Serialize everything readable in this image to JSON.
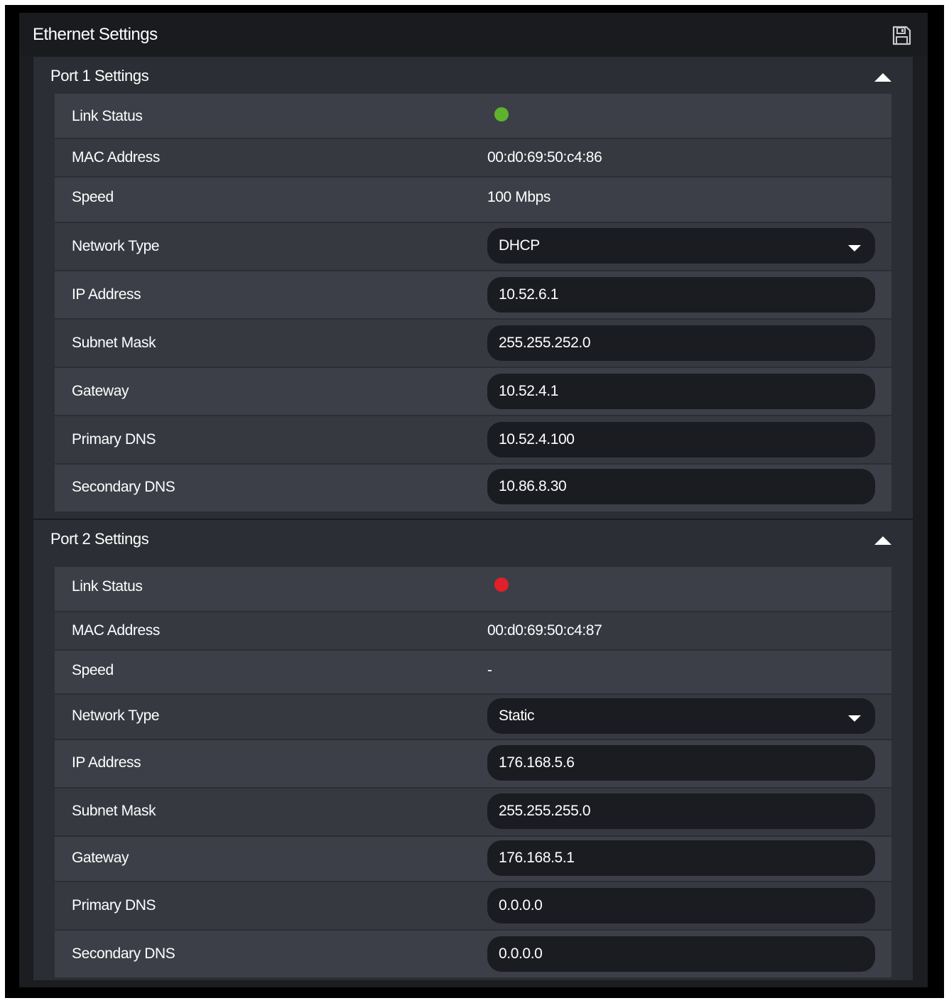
{
  "panel": {
    "title": "Ethernet Settings",
    "save_icon": "floppy-disk-save-icon"
  },
  "colors": {
    "link_up": "#5db32d",
    "link_down": "#e0202a",
    "panel_bg": "#1c1d20",
    "field_bg": "#1a1c21"
  },
  "ports": [
    {
      "title": "Port 1 Settings",
      "collapse_icon": "caret-up-icon",
      "link_status_label": "Link Status",
      "link_status": "up",
      "mac_label": "MAC Address",
      "mac": "00:d0:69:50:c4:86",
      "speed_label": "Speed",
      "speed": "100 Mbps",
      "network_type_label": "Network Type",
      "network_type": "DHCP",
      "ip_label": "IP Address",
      "ip": "10.52.6.1",
      "subnet_label": "Subnet Mask",
      "subnet": "255.255.252.0",
      "gateway_label": "Gateway",
      "gateway": "10.52.4.1",
      "primary_dns_label": "Primary DNS",
      "primary_dns": "10.52.4.100",
      "secondary_dns_label": "Secondary DNS",
      "secondary_dns": "10.86.8.30"
    },
    {
      "title": "Port 2 Settings",
      "collapse_icon": "caret-up-icon",
      "link_status_label": "Link Status",
      "link_status": "down",
      "mac_label": "MAC Address",
      "mac": "00:d0:69:50:c4:87",
      "speed_label": "Speed",
      "speed": "-",
      "network_type_label": "Network Type",
      "network_type": "Static",
      "ip_label": "IP Address",
      "ip": "176.168.5.6",
      "subnet_label": "Subnet Mask",
      "subnet": "255.255.255.0",
      "gateway_label": "Gateway",
      "gateway": "176.168.5.1",
      "primary_dns_label": "Primary DNS",
      "primary_dns": "0.0.0.0",
      "secondary_dns_label": "Secondary DNS",
      "secondary_dns": "0.0.0.0"
    }
  ]
}
